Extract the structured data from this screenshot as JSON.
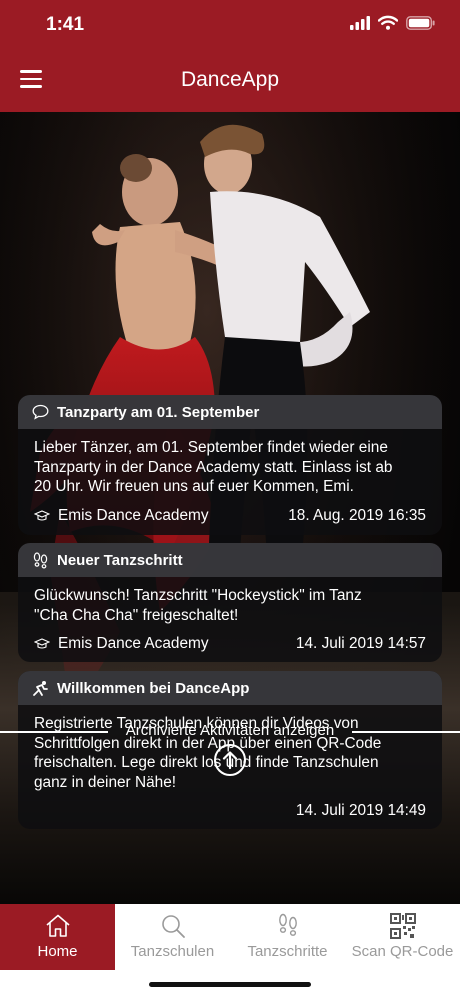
{
  "status_bar": {
    "time": "1:41"
  },
  "app_bar": {
    "title": "DanceApp",
    "menu_icon": "hamburger-menu-icon"
  },
  "colors": {
    "brand": "#9b1b24",
    "card_header": "#3a3a3e",
    "card_body": "#0e0e10",
    "tab_inactive": "#9a9a9a"
  },
  "feed": [
    {
      "icon": "speech-bubble-icon",
      "title": "Tanzparty am 01. September",
      "body": [
        "Lieber Tänzer, am 01. September findet wieder eine",
        "Tanzparty in der Dance Academy statt. Einlass ist ab",
        "20 Uhr. Wir freuen uns auf euer Kommen, Emi."
      ],
      "school": "Emis Dance Academy",
      "date": "18. Aug. 2019 16:35"
    },
    {
      "icon": "footprints-icon",
      "title": "Neuer Tanzschritt",
      "body": [
        "Glückwunsch! Tanzschritt \"Hockeystick\" im Tanz",
        "\"Cha Cha Cha\" freigeschaltet!"
      ],
      "school": "Emis Dance Academy",
      "date": "14. Juli 2019 14:57"
    },
    {
      "icon": "dancer-icon",
      "title": "Willkommen bei DanceApp",
      "body": [
        "Registrierte Tanzschulen können dir Videos von",
        "Schrittfolgen direkt in der App über einen QR-Code",
        "freischalten. Lege direkt los und finde Tanzschulen",
        "ganz in deiner Nähe!"
      ],
      "school": "",
      "date": "14. Juli 2019 14:49"
    }
  ],
  "archive": {
    "label": "Archivierte Aktivitäten anzeigen"
  },
  "tabs": [
    {
      "label": "Home",
      "icon": "home-icon",
      "active": true
    },
    {
      "label": "Tanzschulen",
      "icon": "search-icon",
      "active": false
    },
    {
      "label": "Tanzschritte",
      "icon": "footprints-icon",
      "active": false
    },
    {
      "label": "Scan QR-Code",
      "icon": "qr-code-icon",
      "active": false
    }
  ]
}
